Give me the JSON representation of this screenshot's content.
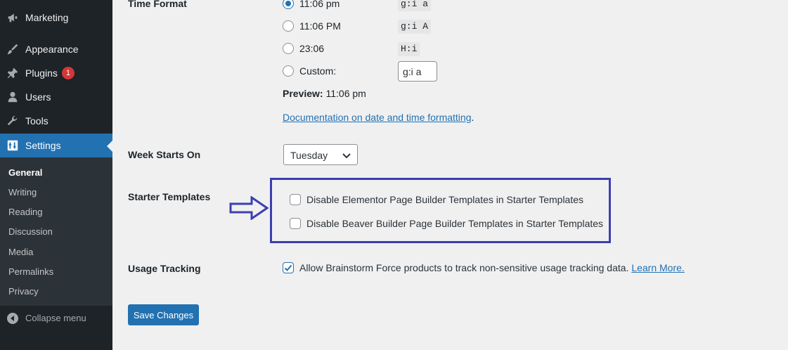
{
  "sidebar": {
    "items": [
      {
        "label": "Marketing",
        "icon": "megaphone-icon"
      },
      {
        "label": "Appearance",
        "icon": "paintbrush-icon"
      },
      {
        "label": "Plugins",
        "icon": "plugin-icon",
        "badge": "1"
      },
      {
        "label": "Users",
        "icon": "users-icon"
      },
      {
        "label": "Tools",
        "icon": "wrench-icon"
      },
      {
        "label": "Settings",
        "icon": "settings-icon",
        "active": true
      }
    ],
    "submenu": [
      "General",
      "Writing",
      "Reading",
      "Discussion",
      "Media",
      "Permalinks",
      "Privacy"
    ],
    "collapse_label": "Collapse menu"
  },
  "time_format": {
    "label": "Time Format",
    "options": [
      {
        "label": "11:06 pm",
        "code": "g:i a",
        "checked": true
      },
      {
        "label": "11:06 PM",
        "code": "g:i A",
        "checked": false
      },
      {
        "label": "23:06",
        "code": "H:i",
        "checked": false
      },
      {
        "label": "Custom:",
        "checked": false
      }
    ],
    "custom_value": "g:i a",
    "preview_label": "Preview:",
    "preview_value": "11:06 pm",
    "doc_link": "Documentation on date and time formatting",
    "doc_suffix": "."
  },
  "week_starts": {
    "label": "Week Starts On",
    "selected": "Tuesday"
  },
  "starter_templates": {
    "label": "Starter Templates",
    "options": [
      {
        "label": "Disable Elementor Page Builder Templates in Starter Templates",
        "checked": false
      },
      {
        "label": "Disable Beaver Builder Page Builder Templates in Starter Templates",
        "checked": false
      }
    ]
  },
  "usage_tracking": {
    "label": "Usage Tracking",
    "text": "Allow Brainstorm Force products to track non-sensitive usage tracking data.",
    "link": "Learn More.",
    "checked": true
  },
  "save_label": "Save Changes",
  "colors": {
    "sidebar_bg": "#1d2327",
    "submenu_bg": "#2c3338",
    "accent": "#2271b1",
    "badge": "#d63638",
    "highlight_box": "#3b3fb0"
  }
}
